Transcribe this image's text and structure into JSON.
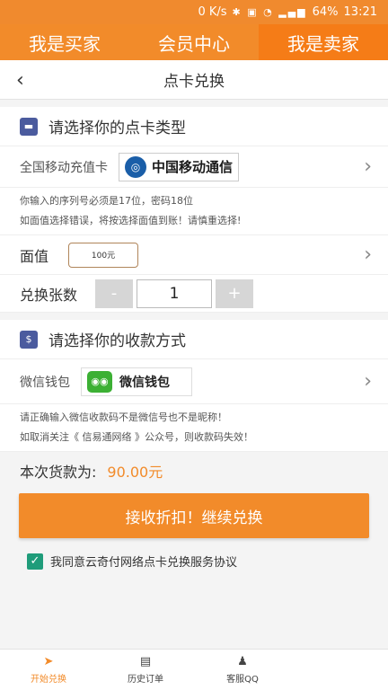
{
  "statusbar": {
    "net": "0 K/s",
    "battery": "64%",
    "time": "13:21"
  },
  "topnav": {
    "tabs": [
      {
        "label": "我是买家"
      },
      {
        "label": "会员中心"
      },
      {
        "label": "我是卖家"
      }
    ]
  },
  "titlebar": {
    "back": "‹",
    "title": "点卡兑换"
  },
  "section_card": {
    "title": "请选择你的点卡类型"
  },
  "card_type": {
    "label": "全国移动充值卡",
    "logo_text": "中国移动通信"
  },
  "card_notes": [
    "你输入的序列号必须是17位，密码18位",
    "如面值选择错误，将按选择面值到账！请慎重选择!"
  ],
  "face_value": {
    "label": "面值",
    "value": "100元"
  },
  "quantity": {
    "label": "兑换张数",
    "minus": "-",
    "value": "1",
    "plus": "+"
  },
  "section_pay": {
    "title": "请选择你的收款方式"
  },
  "wallet": {
    "label": "微信钱包",
    "logo_text": "微信钱包"
  },
  "wallet_notes": [
    "请正确输入微信收款码不是微信号也不是昵称！",
    "如取消关注《 信易通网络 》公众号，则收款码失效！"
  ],
  "total": {
    "label": "本次货款为:",
    "amount": "90.00元"
  },
  "submit_label": "接收折扣！继续兑换",
  "agreement": "我同意云奇付网络点卡兑换服务协议",
  "bottombar": [
    {
      "label": "开始兑换"
    },
    {
      "label": "历史订单"
    },
    {
      "label": "客服QQ"
    }
  ],
  "colors": {
    "accent": "#f28b2a",
    "checkbox": "#1f9c7a"
  }
}
